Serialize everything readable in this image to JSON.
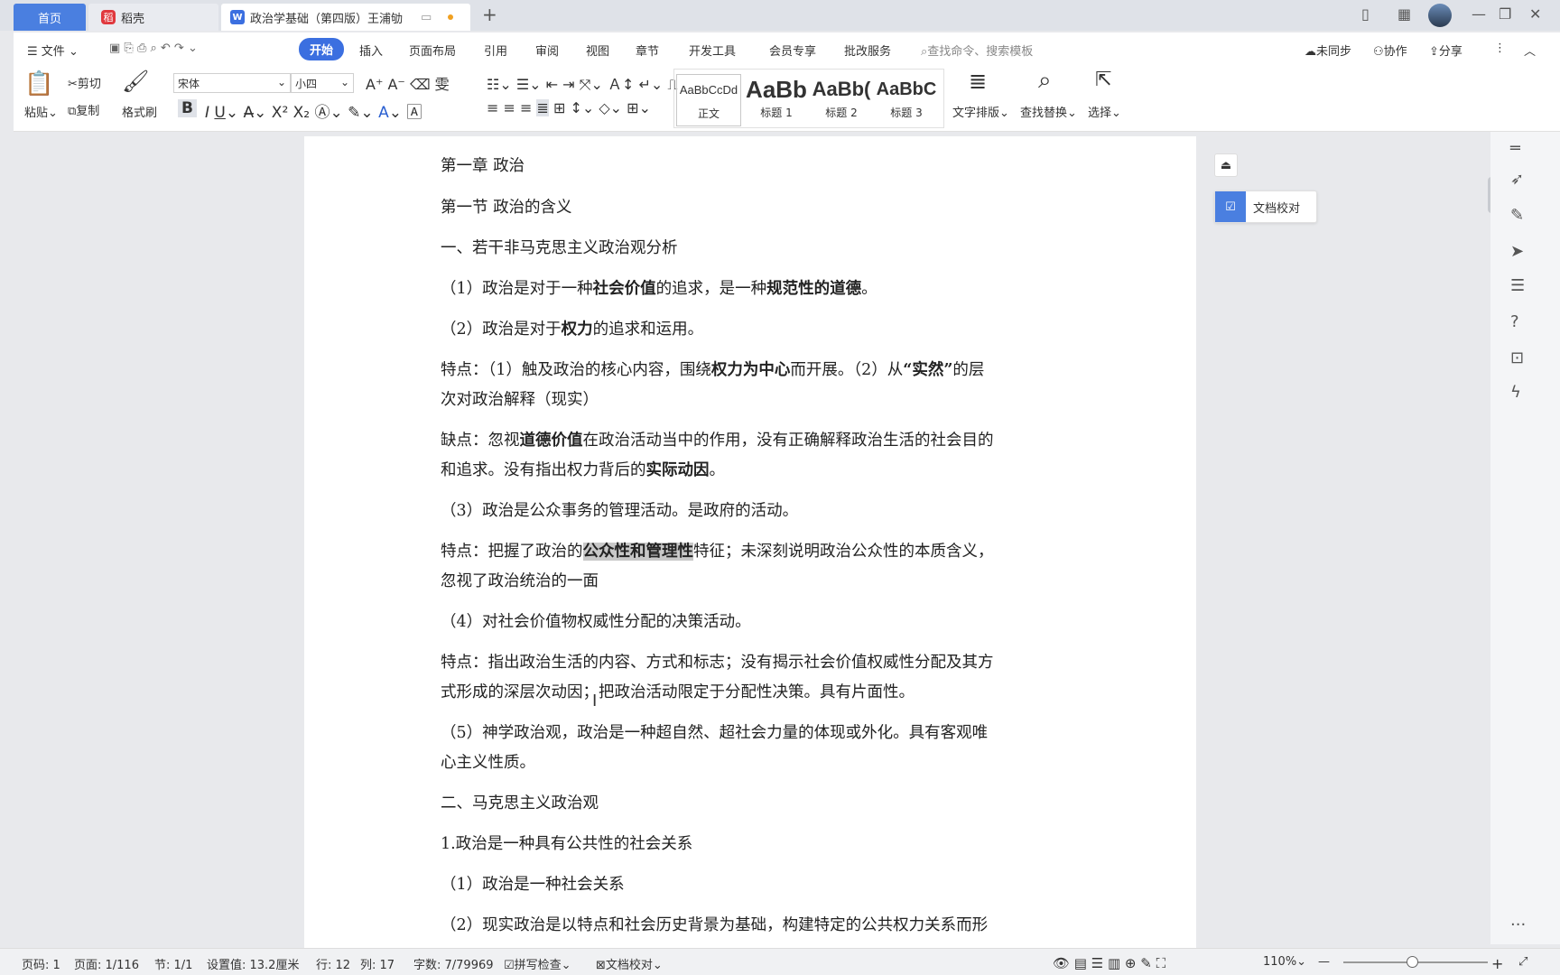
{
  "tabs": {
    "home": "首页",
    "daoke": "稻壳",
    "doc": "政治学基础（第四版）王浦劬"
  },
  "menu": {
    "file": "文件",
    "items": [
      "开始",
      "插入",
      "页面布局",
      "引用",
      "审阅",
      "视图",
      "章节",
      "开发工具",
      "会员专享",
      "批改服务"
    ],
    "search_placeholder": "查找命令、搜索模板",
    "sync": "未同步",
    "collab": "协作",
    "share": "分享"
  },
  "ribbon": {
    "paste": "粘贴",
    "cut": "剪切",
    "copy": "复制",
    "format_painter": "格式刷",
    "font": "宋体",
    "size": "小四",
    "styles": [
      {
        "sample": "AaBbCcDd",
        "label": "正文"
      },
      {
        "sample": "AaBb",
        "label": "标题 1"
      },
      {
        "sample": "AaBb(",
        "label": "标题 2"
      },
      {
        "sample": "AaBbC",
        "label": "标题 3"
      }
    ],
    "text_layout": "文字排版",
    "find_replace": "查找替换",
    "select": "选择"
  },
  "doc": {
    "l1": "第一章 政治",
    "l2": "第一节 政治的含义",
    "l3": "一、若干非马克思主义政治观分析",
    "l4": [
      "（1）政治是对于一种",
      "社会价值",
      "的追求，是一种",
      "规范性的道德",
      "。"
    ],
    "l5": [
      "（2）政治是对于",
      "权力",
      "的追求和运用。"
    ],
    "l6": [
      "特点：（1）触及政治的核心内容，围绕",
      "权力为中心",
      "而开展。（2）从",
      "“实然”",
      "的层"
    ],
    "l6b": "次对政治解释（现实）",
    "l7": [
      "缺点：忽视",
      "道德价值",
      "在政治活动当中的作用，没有正确解释政治生活的社会目的"
    ],
    "l7b": [
      "和追求。没有指出权力背后的",
      "实际动因",
      "。"
    ],
    "l8": "（3）政治是公众事务的管理活动。是政府的活动。",
    "l9": [
      "特点：把握了政治的",
      "公众性和管理性",
      "特征；未深刻说明政治公众性的本质含义，"
    ],
    "l9b": "忽视了政治统治的一面",
    "l10": "（4）对社会价值物权威性分配的决策活动。",
    "l11": "特点：指出政治生活的内容、方式和标志；没有揭示社会价值权威性分配及其方",
    "l11b": "式形成的深层次动因；把政治活动限定于分配性决策。具有片面性。",
    "l12": "（5）神学政治观，政治是一种超自然、超社会力量的体现或外化。具有客观唯",
    "l12b": "心主义性质。",
    "l13": "二、马克思主义政治观",
    "l14": "1.政治是一种具有公共性的社会关系",
    "l15": "（1）政治是一种社会关系",
    "l16": "（2）现实政治是以特点和社会历史背景为基础，构建特定的公共权力关系而形"
  },
  "panel": {
    "proofread": "文档校对"
  },
  "status": {
    "page_code": "页码: 1",
    "pages": "页面: 1/116",
    "section": "节: 1/1",
    "setting": "设置值: 13.2厘米",
    "row": "行: 12",
    "col": "列: 17",
    "words": "字数: 7/79969",
    "spellcheck": "拼写检查",
    "proof": "文档校对",
    "zoom": "110%"
  }
}
